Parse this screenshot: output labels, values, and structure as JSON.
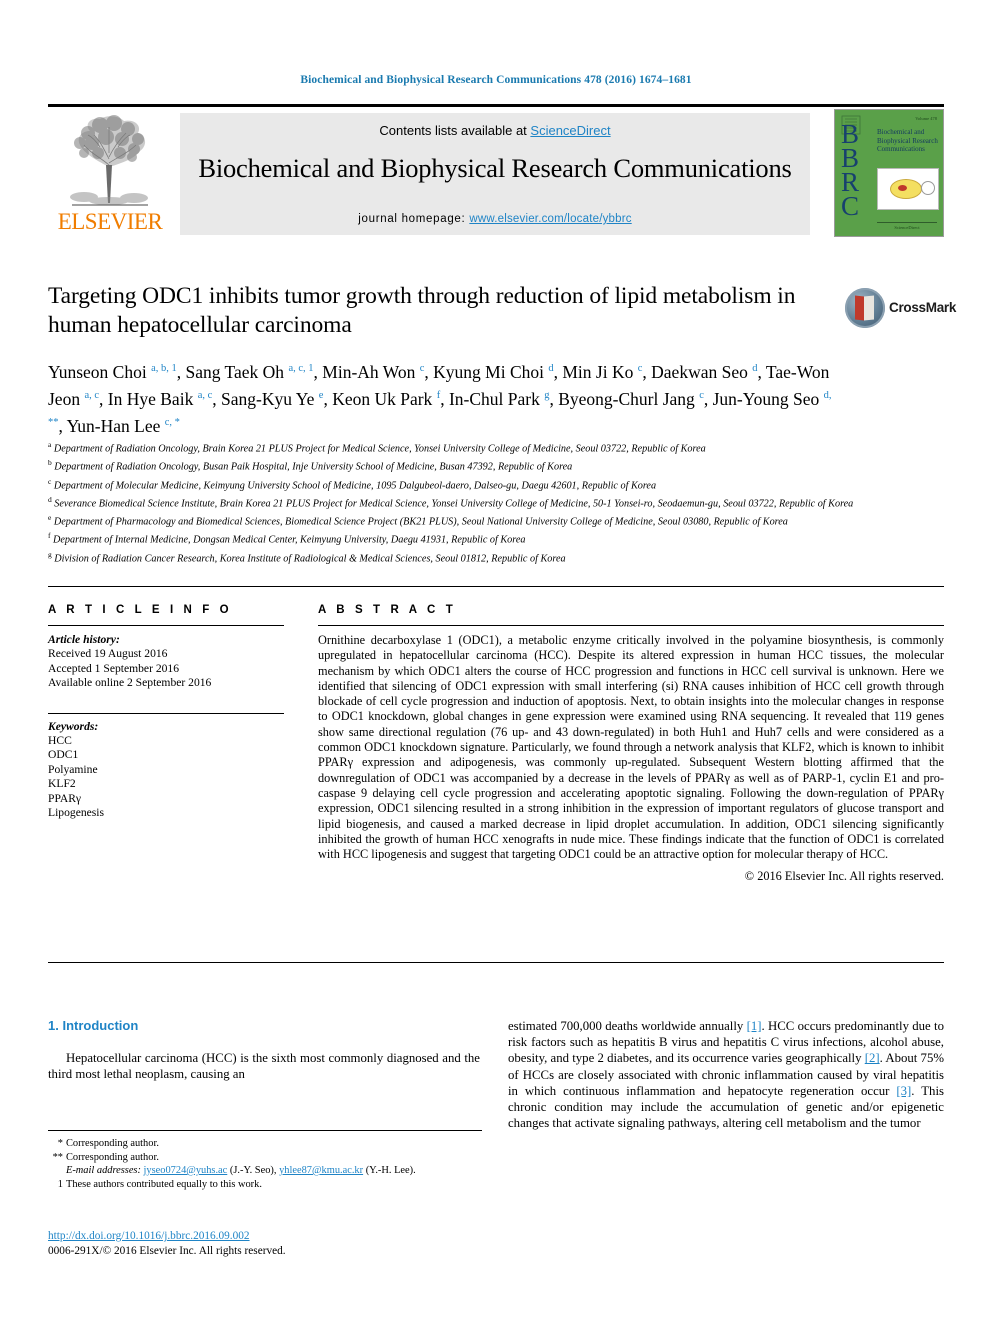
{
  "running_head": "Biochemical and Biophysical Research Communications 478 (2016) 1674–1681",
  "masthead": {
    "publisher_name": "ELSEVIER",
    "contents_prefix": "Contents lists available at ",
    "contents_link": "ScienceDirect",
    "journal_title": "Biochemical and Biophysical Research Communications",
    "homepage_prefix": "journal homepage: ",
    "homepage_url": "www.elsevier.com/locate/ybbrc",
    "cover": {
      "acronym": "BBRC",
      "title_lines": "Biochemical and Biophysical Research Communications",
      "footer_text": "ScienceDirect",
      "corner_text": "Volume 478"
    }
  },
  "article": {
    "title": "Targeting ODC1 inhibits tumor growth through reduction of lipid metabolism in human hepatocellular carcinoma",
    "crossmark_label": "CrossMark",
    "authors_html": "Yunseon Choi <sup>a, b, 1</sup>, Sang Taek Oh <sup>a, c, 1</sup>, Min-Ah Won <sup>c</sup>, Kyung Mi Choi <sup>d</sup>, Min Ji Ko <sup>c</sup>, Daekwan Seo <sup>d</sup>, Tae-Won Jeon <sup>a, c</sup>, In Hye Baik <sup>a, c</sup>, Sang-Kyu Ye <sup>e</sup>, Keon Uk Park <sup>f</sup>, In-Chul Park <sup>g</sup>, Byeong-Churl Jang <sup>c</sup>, Jun-Young Seo <sup>d, **</sup>, Yun-Han Lee <sup>c, *</sup>",
    "affiliations": [
      {
        "mark": "a",
        "text": "Department of Radiation Oncology, Brain Korea 21 PLUS Project for Medical Science, Yonsei University College of Medicine, Seoul 03722, Republic of Korea"
      },
      {
        "mark": "b",
        "text": "Department of Radiation Oncology, Busan Paik Hospital, Inje University School of Medicine, Busan 47392, Republic of Korea"
      },
      {
        "mark": "c",
        "text": "Department of Molecular Medicine, Keimyung University School of Medicine, 1095 Dalgubeol-daero, Dalseo-gu, Daegu 42601, Republic of Korea"
      },
      {
        "mark": "d",
        "text": "Severance Biomedical Science Institute, Brain Korea 21 PLUS Project for Medical Science, Yonsei University College of Medicine, 50-1 Yonsei-ro, Seodaemun-gu, Seoul 03722, Republic of Korea"
      },
      {
        "mark": "e",
        "text": "Department of Pharmacology and Biomedical Sciences, Biomedical Science Project (BK21 PLUS), Seoul National University College of Medicine, Seoul 03080, Republic of Korea"
      },
      {
        "mark": "f",
        "text": "Department of Internal Medicine, Dongsan Medical Center, Keimyung University, Daegu 41931, Republic of Korea"
      },
      {
        "mark": "g",
        "text": "Division of Radiation Cancer Research, Korea Institute of Radiological & Medical Sciences, Seoul 01812, Republic of Korea"
      }
    ]
  },
  "article_info": {
    "heading": "A R T I C L E   I N F O",
    "history_label": "Article history:",
    "history": [
      "Received 19 August 2016",
      "Accepted 1 September 2016",
      "Available online 2 September 2016"
    ],
    "keywords_label": "Keywords:",
    "keywords": [
      "HCC",
      "ODC1",
      "Polyamine",
      "KLF2",
      "PPARγ",
      "Lipogenesis"
    ]
  },
  "abstract": {
    "heading": "A B S T R A C T",
    "text": "Ornithine decarboxylase 1 (ODC1), a metabolic enzyme critically involved in the polyamine biosynthesis, is commonly upregulated in hepatocellular carcinoma (HCC). Despite its altered expression in human HCC tissues, the molecular mechanism by which ODC1 alters the course of HCC progression and functions in HCC cell survival is unknown. Here we identified that silencing of ODC1 expression with small interfering (si) RNA causes inhibition of HCC cell growth through blockade of cell cycle progression and induction of apoptosis. Next, to obtain insights into the molecular changes in response to ODC1 knockdown, global changes in gene expression were examined using RNA sequencing. It revealed that 119 genes show same directional regulation (76 up- and 43 down-regulated) in both Huh1 and Huh7 cells and were considered as a common ODC1 knockdown signature. Particularly, we found through a network analysis that KLF2, which is known to inhibit PPARγ expression and adipogenesis, was commonly up-regulated. Subsequent Western blotting affirmed that the downregulation of ODC1 was accompanied by a decrease in the levels of PPARγ as well as of PARP-1, cyclin E1 and pro-caspase 9 delaying cell cycle progression and accelerating apoptotic signaling. Following the down-regulation of PPARγ expression, ODC1 silencing resulted in a strong inhibition in the expression of important regulators of glucose transport and lipid biogenesis, and caused a marked decrease in lipid droplet accumulation. In addition, ODC1 silencing significantly inhibited the growth of human HCC xenografts in nude mice. These findings indicate that the function of ODC1 is correlated with HCC lipogenesis and suggest that targeting ODC1 could be an attractive option for molecular therapy of HCC.",
    "copyright": "© 2016 Elsevier Inc. All rights reserved."
  },
  "introduction": {
    "section_number_title": "1. Introduction",
    "left_paragraph": "Hepatocellular carcinoma (HCC) is the sixth most commonly diagnosed and the third most lethal neoplasm, causing an",
    "right_paragraph_parts": [
      "estimated 700,000 deaths worldwide annually ",
      "[1]",
      ". HCC occurs predominantly due to risk factors such as hepatitis B virus and hepatitis C virus infections, alcohol abuse, obesity, and type 2 diabetes, and its occurrence varies geographically ",
      "[2]",
      ". About 75% of HCCs are closely associated with chronic inflammation caused by viral hepatitis in which continuous inflammation and hepatocyte regeneration occur ",
      "[3]",
      ". This chronic condition may include the accumulation of genetic and/or epigenetic changes that activate signaling pathways, altering cell metabolism and the tumor"
    ]
  },
  "footnotes": {
    "corr1_mark": "*",
    "corr1_text": "Corresponding author.",
    "corr2_mark": "**",
    "corr2_text": "Corresponding author.",
    "email_label": "E-mail addresses:",
    "email1": "jyseo0724@yuhs.ac",
    "email1_owner": "(J.-Y. Seo),",
    "email2": "yhlee87@kmu.ac.kr",
    "email2_owner": "(Y.-H. Lee).",
    "equal_mark": "1",
    "equal_text": "These authors contributed equally to this work."
  },
  "doi_block": {
    "doi_url": "http://dx.doi.org/10.1016/j.bbrc.2016.09.002",
    "issn_line": "0006-291X/© 2016 Elsevier Inc. All rights reserved."
  },
  "colors": {
    "link_blue": "#1f84c6",
    "header_blue": "#1a7aaf",
    "elsevier_orange": "#F07D00",
    "cover_green": "#5aa049"
  }
}
